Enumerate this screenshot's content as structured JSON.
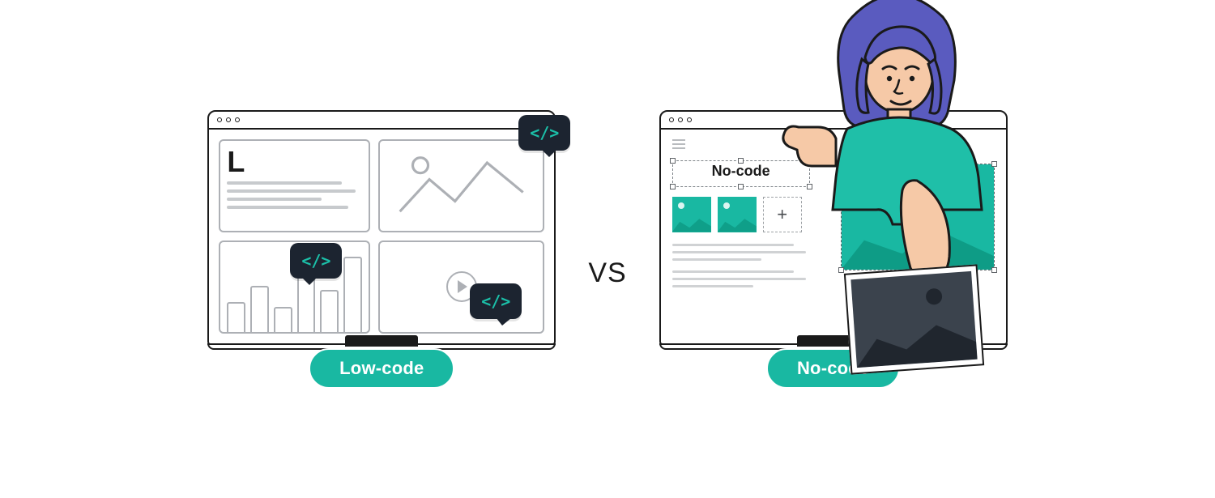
{
  "left": {
    "pill": "Low-code",
    "letter": "L",
    "code_snippet": "</>"
  },
  "center": {
    "vs": "VS"
  },
  "right": {
    "pill": "No-code",
    "editor_label": "No-code",
    "add_symbol": "+"
  },
  "colors": {
    "teal": "#19b8a2",
    "dark": "#1c2430"
  }
}
